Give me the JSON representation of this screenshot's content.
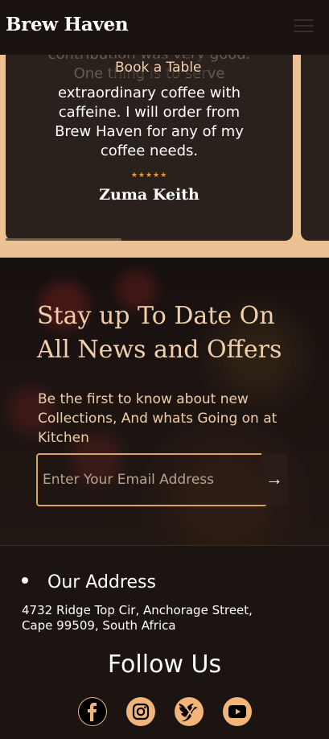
{
  "header": {
    "brand": "Brew Haven",
    "menu_icon": "hamburger-menu-icon"
  },
  "testimonial": {
    "text_lines": [
      "contribution was very good.",
      "One thing is to serve",
      "extraordinary coffee with",
      "caffeine. I will order from",
      "Brew Haven for any of my",
      "coffee needs."
    ],
    "book_label": "Book a Table",
    "stars": "★★★★★",
    "author": "Zuma Keith"
  },
  "newsletter": {
    "title": "Stay up To Date On All News and Offers",
    "subtitle": "Be the first to know about new Collections, And whats Going on at Kitchen",
    "email_placeholder": "Enter Your Email Address",
    "submit_arrow": "→"
  },
  "footer": {
    "address_title": "Our Address",
    "address_text": "4732 Ridge Top Cir, Anchorage Street, Cape 99509, South Africa",
    "follow_title": "Follow Us",
    "social_icons": [
      "facebook-icon",
      "instagram-icon",
      "x-twitter-icon",
      "youtube-icon"
    ]
  },
  "colors": {
    "accent": "#f1b57a",
    "card": "#2b211c",
    "section_bg": "#ecc193",
    "text_gold": "#f1cfac"
  }
}
